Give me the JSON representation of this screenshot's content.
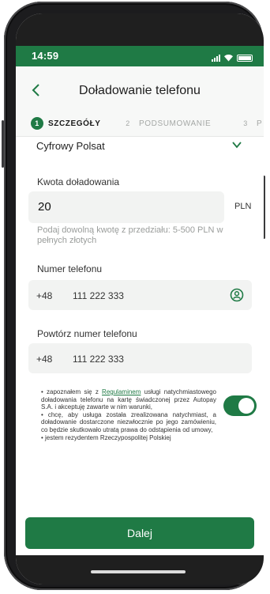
{
  "status": {
    "time": "14:59"
  },
  "header": {
    "title": "Doładowanie telefonu"
  },
  "steps": [
    {
      "num": "1",
      "label": "SZCZEGÓŁY"
    },
    {
      "num": "2",
      "label": "PODSUMOWANIE"
    },
    {
      "num": "3",
      "label": "P"
    }
  ],
  "form": {
    "operator": "Cyfrowy Polsat",
    "amount_label": "Kwota doładowania",
    "amount_value": "20",
    "currency": "PLN",
    "amount_hint": "Podaj dowolną kwotę z przedziału: 5-500 PLN w pełnych złotych",
    "phone_label": "Numer telefonu",
    "phone_prefix": "+48",
    "phone_value": "111 222 333",
    "repeat_label": "Powtórz numer telefonu",
    "repeat_prefix": "+48",
    "repeat_value": "111 222 333"
  },
  "consent": {
    "pre_link": "• zapoznałem się z ",
    "link": "Regulaminem",
    "post_link": " usługi natychmiastowego doładowania telefonu na kartę świadczonej przez Autopay S.A. i akceptuję zawarte w nim warunki,",
    "line2": "• chcę, aby usługa została zrealizowana natychmiast, a doładowanie dostarczone niezwłocznie po jego zamówieniu, co będzie skutkowało utratą prawa do odstąpienia od umowy,",
    "line3": "• jestem rezydentem Rzeczypospolitej Polskiej",
    "toggle_on": true
  },
  "actions": {
    "next_label": "Dalej"
  },
  "colors": {
    "accent": "#1f7a45",
    "field_bg": "#f2f3f2"
  },
  "icons": [
    "back-arrow-icon",
    "chevron-down-icon",
    "contact-book-icon",
    "signal-icon",
    "wifi-icon",
    "battery-icon"
  ]
}
